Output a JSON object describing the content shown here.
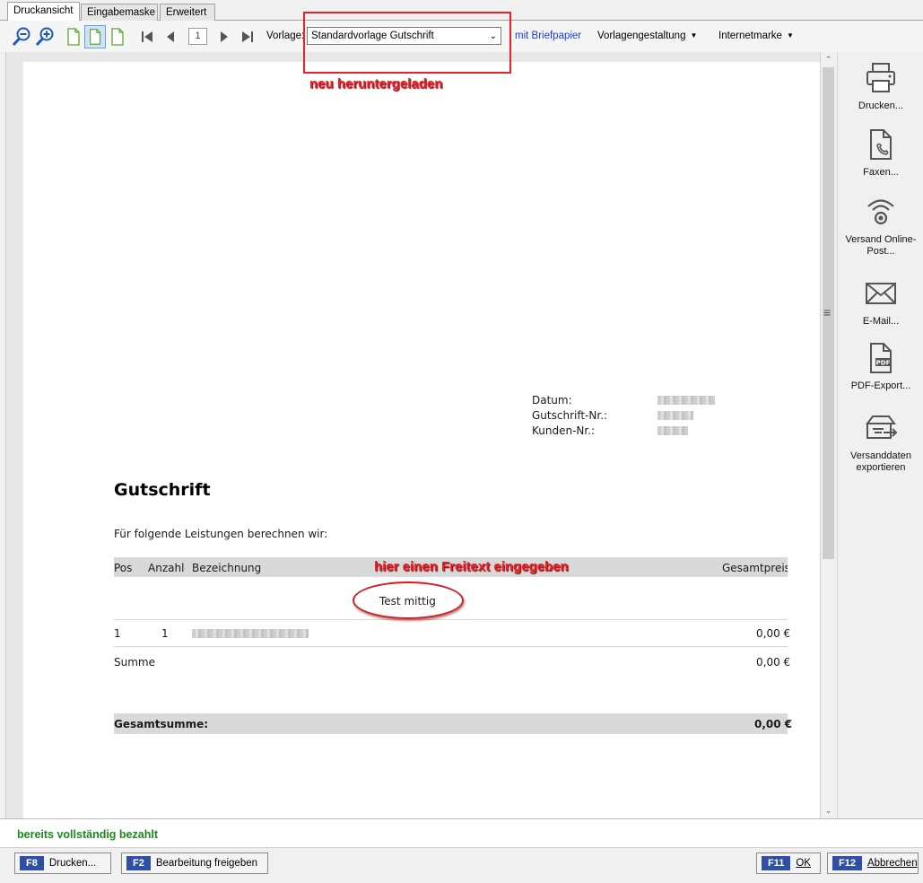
{
  "tabs": [
    {
      "label": "Druckansicht"
    },
    {
      "label": "Eingabemaske"
    },
    {
      "label": "Erweitert"
    }
  ],
  "toolbar": {
    "page_number": "1",
    "vorlage_label": "Vorlage:",
    "vorlage_value": "Standardvorlage Gutschrift",
    "briefpapier_label": "mit Briefpapier",
    "vorlagengestaltung_label": "Vorlagengestaltung",
    "internetmarke_label": "Internetmarke"
  },
  "annotations": {
    "box_note": "neu heruntergeladen",
    "freetext_note": "hier einen Freitext eingegeben"
  },
  "document": {
    "datum_label": "Datum:",
    "gutschrift_nr_label": "Gutschrift-Nr.:",
    "kunden_nr_label": "Kunden-Nr.:",
    "title": "Gutschrift",
    "intro": "Für folgende Leistungen berechnen wir:",
    "columns": {
      "pos": "Pos",
      "anzahl": "Anzahl",
      "bezeichnung": "Bezeichnung",
      "gesamtpreis": "Gesamtpreis"
    },
    "freetext": "Test mittig",
    "rows": [
      {
        "pos": "1",
        "anzahl": "1",
        "gesamtpreis": "0,00 €"
      }
    ],
    "summe_label": "Summe",
    "summe_value": "0,00 €",
    "gesamtsumme_label": "Gesamtsumme:",
    "gesamtsumme_value": "0,00 €"
  },
  "actions": [
    {
      "label": "Drucken...",
      "icon": "printer-icon"
    },
    {
      "label": "Faxen...",
      "icon": "fax-icon"
    },
    {
      "label": "Versand Online-Post...",
      "icon": "online-post-icon"
    },
    {
      "label": "E-Mail...",
      "icon": "envelope-icon"
    },
    {
      "label": "PDF-Export...",
      "icon": "pdf-icon"
    },
    {
      "label": "Versanddaten exportieren",
      "icon": "box-export-icon"
    }
  ],
  "status": {
    "text": "bereits vollständig bezahlt",
    "color": "#1c8a1c"
  },
  "footer_buttons": [
    {
      "key": "F8",
      "label": "Drucken..."
    },
    {
      "key": "F2",
      "label": "Bearbeitung freigeben"
    },
    {
      "key": "F11",
      "label": "OK"
    },
    {
      "key": "F12",
      "label": "Abbrechen"
    }
  ],
  "colors": {
    "accent": "#2f4fa4",
    "annotation": "#e8202a",
    "link": "#1a3cd8"
  }
}
